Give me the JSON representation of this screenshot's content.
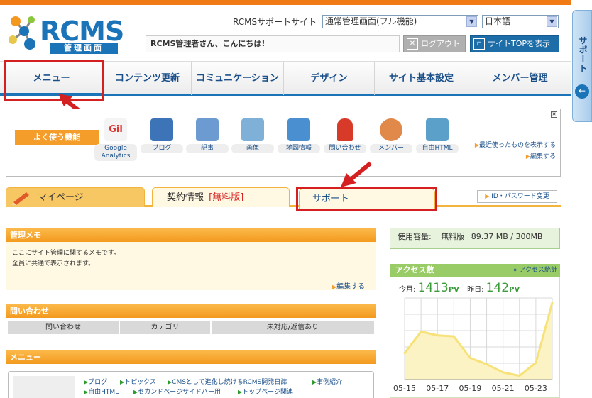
{
  "logo": {
    "text": "RCMS",
    "subtitle": "管理画面"
  },
  "header": {
    "site_label": "RCMSサポートサイト",
    "mode_select": "通常管理画面(フル機能)",
    "lang_select": "日本語",
    "greeting": "RCMS管理者さん、こんにちは!",
    "logout": "ログアウト",
    "site_top": "サイトTOPを表示"
  },
  "nav": [
    "メニュー",
    "コンテンツ更新",
    "コミュニケーション",
    "デザイン",
    "サイト基本設定",
    "メンバー管理"
  ],
  "favorites": {
    "label": "よく使う機能",
    "items": [
      {
        "label": "Google Analytics",
        "icon": "google-analytics-icon",
        "color": "#e8e8e8"
      },
      {
        "label": "ブログ",
        "icon": "blog-icon",
        "color": "#3d74b8"
      },
      {
        "label": "記事",
        "icon": "article-icon",
        "color": "#6b9bd0"
      },
      {
        "label": "画像",
        "icon": "image-icon",
        "color": "#7fb0d8"
      },
      {
        "label": "地図情報",
        "icon": "map-icon",
        "color": "#4a8fd0"
      },
      {
        "label": "問い合わせ",
        "icon": "mailbox-icon",
        "color": "#d83a2a"
      },
      {
        "label": "メンバー",
        "icon": "members-icon",
        "color": "#e0894a"
      },
      {
        "label": "自由HTML",
        "icon": "html-icon",
        "color": "#5aa0c8"
      }
    ],
    "recent_link": "最近使ったものを表示する",
    "edit_link": "編集する"
  },
  "tabs": {
    "mypage": "マイページ",
    "contract": "契約情報",
    "contract_tag": "[無料版]",
    "support": "サポート",
    "id_password": "ID・パスワード変更"
  },
  "memo": {
    "title": "管理メモ",
    "lines": [
      "ここにサイト管理に関するメモです。",
      "全員に共通で表示されます。"
    ],
    "edit": "編集する"
  },
  "inquiry": {
    "title": "問い合わせ",
    "columns": [
      "問い合わせ",
      "カテゴリ",
      "未対応/返信あり"
    ]
  },
  "menu": {
    "title": "メニュー",
    "links_row1": [
      "ブログ",
      "トピックス",
      "CMSとして進化し続けるRCMS開発日誌",
      "事例紹介"
    ],
    "links_row2": [
      "自由HTML",
      "セカンドページサイドバー用",
      "トップページ関連"
    ]
  },
  "usage": {
    "label": "使用容量:",
    "plan": "無料版",
    "value": "89.37 MB / 300MB"
  },
  "access": {
    "title": "アクセス数",
    "stats_link": "アクセス統計",
    "today_label": "今月:",
    "today_value": "1413",
    "yesterday_label": "昨日:",
    "yesterday_value": "142",
    "unit": "PV"
  },
  "chart_data": {
    "type": "area",
    "x": [
      "05-15",
      "05-16",
      "05-17",
      "05-18",
      "05-19",
      "05-20",
      "05-21",
      "05-22",
      "05-23",
      "05-24"
    ],
    "x_tick_labels": [
      "05-15",
      "05-17",
      "05-19",
      "05-21",
      "05-23"
    ],
    "values": [
      55,
      100,
      92,
      90,
      45,
      32,
      15,
      8,
      35,
      160
    ],
    "ylim": [
      0,
      170
    ],
    "grid": true,
    "color": "#f7e27a"
  },
  "sidetab": {
    "label": "サポート"
  }
}
